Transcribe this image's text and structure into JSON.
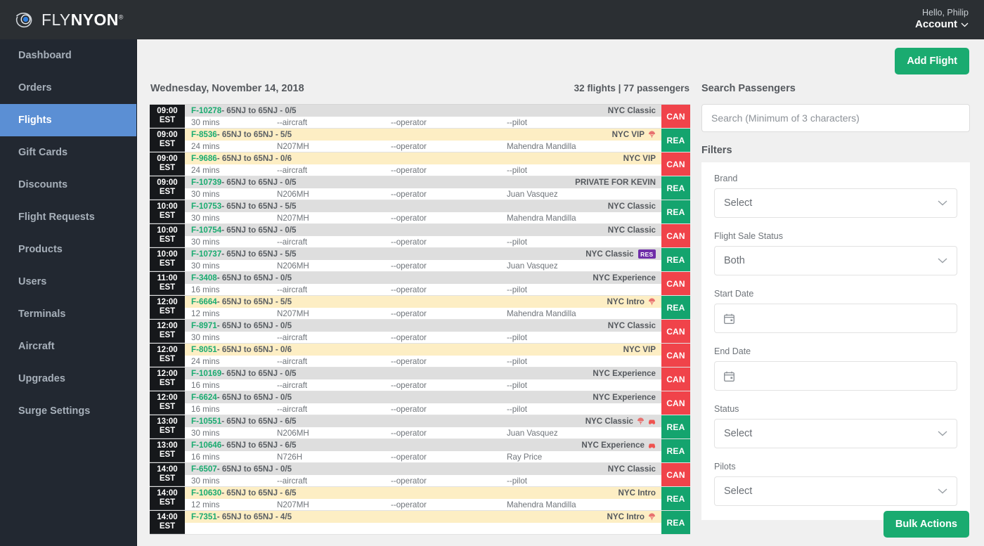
{
  "brand": {
    "name_light": "FLY",
    "name_bold": "NYON",
    "trademark": "®"
  },
  "header": {
    "greeting": "Hello, Philip",
    "account_label": "Account"
  },
  "sidebar": {
    "items": [
      {
        "label": "Dashboard",
        "active": false
      },
      {
        "label": "Orders",
        "active": false
      },
      {
        "label": "Flights",
        "active": true
      },
      {
        "label": "Gift Cards",
        "active": false
      },
      {
        "label": "Discounts",
        "active": false
      },
      {
        "label": "Flight Requests",
        "active": false
      },
      {
        "label": "Products",
        "active": false
      },
      {
        "label": "Users",
        "active": false
      },
      {
        "label": "Terminals",
        "active": false
      },
      {
        "label": "Aircraft",
        "active": false
      },
      {
        "label": "Upgrades",
        "active": false
      },
      {
        "label": "Surge Settings",
        "active": false
      }
    ]
  },
  "toolbar": {
    "add_flight_label": "Add Flight",
    "bulk_actions_label": "Bulk Actions"
  },
  "flight_list": {
    "date": "Wednesday, November 14, 2018",
    "summary": "32 flights | 77 passengers",
    "rows": [
      {
        "time": "09:00",
        "tz": "EST",
        "id": "F-10278",
        "route": " - 65NJ to 65NJ - 0/5",
        "duration": "30 mins",
        "aircraft": "--aircraft",
        "operator": "--operator",
        "pilot": "--pilot",
        "brand": "NYC Classic",
        "highlight": "grey",
        "status": "CAN",
        "icons": [],
        "res": false
      },
      {
        "time": "09:00",
        "tz": "EST",
        "id": "F-8536",
        "route": " - 65NJ to 65NJ - 5/5",
        "duration": "24 mins",
        "aircraft": "N207MH",
        "operator": "--operator",
        "pilot": "Mahendra Mandilla",
        "brand": "NYC VIP",
        "highlight": "yellow",
        "status": "REA",
        "icons": [
          "parachute-icon"
        ],
        "res": false
      },
      {
        "time": "09:00",
        "tz": "EST",
        "id": "F-9686",
        "route": " - 65NJ to 65NJ - 0/6",
        "duration": "24 mins",
        "aircraft": "--aircraft",
        "operator": "--operator",
        "pilot": "--pilot",
        "brand": "NYC VIP",
        "highlight": "yellow",
        "status": "CAN",
        "icons": [],
        "res": false
      },
      {
        "time": "09:00",
        "tz": "EST",
        "id": "F-10739",
        "route": " - 65NJ to 65NJ - 0/5",
        "duration": "30 mins",
        "aircraft": "N206MH",
        "operator": "--operator",
        "pilot": "Juan Vasquez",
        "brand": "PRIVATE FOR KEVIN",
        "highlight": "grey",
        "status": "REA",
        "icons": [],
        "res": false
      },
      {
        "time": "10:00",
        "tz": "EST",
        "id": "F-10753",
        "route": " - 65NJ to 65NJ - 5/5",
        "duration": "30 mins",
        "aircraft": "N207MH",
        "operator": "--operator",
        "pilot": "Mahendra Mandilla",
        "brand": "NYC Classic",
        "highlight": "grey",
        "status": "REA",
        "icons": [],
        "res": false
      },
      {
        "time": "10:00",
        "tz": "EST",
        "id": "F-10754",
        "route": " - 65NJ to 65NJ - 0/5",
        "duration": "30 mins",
        "aircraft": "--aircraft",
        "operator": "--operator",
        "pilot": "--pilot",
        "brand": "NYC Classic",
        "highlight": "grey",
        "status": "CAN",
        "icons": [],
        "res": false
      },
      {
        "time": "10:00",
        "tz": "EST",
        "id": "F-10737",
        "route": " - 65NJ to 65NJ - 5/5",
        "duration": "30 mins",
        "aircraft": "N206MH",
        "operator": "--operator",
        "pilot": "Juan Vasquez",
        "brand": "NYC Classic",
        "highlight": "grey",
        "status": "REA",
        "icons": [],
        "res": true,
        "res_label": "RES"
      },
      {
        "time": "11:00",
        "tz": "EST",
        "id": "F-3408",
        "route": " - 65NJ to 65NJ - 0/5",
        "duration": "16 mins",
        "aircraft": "--aircraft",
        "operator": "--operator",
        "pilot": "--pilot",
        "brand": "NYC Experience",
        "highlight": "grey",
        "status": "CAN",
        "icons": [],
        "res": false
      },
      {
        "time": "12:00",
        "tz": "EST",
        "id": "F-6664",
        "route": " - 65NJ to 65NJ - 5/5",
        "duration": "12 mins",
        "aircraft": "N207MH",
        "operator": "--operator",
        "pilot": "Mahendra Mandilla",
        "brand": "NYC Intro",
        "highlight": "yellow",
        "status": "REA",
        "icons": [
          "parachute-icon"
        ],
        "res": false
      },
      {
        "time": "12:00",
        "tz": "EST",
        "id": "F-8971",
        "route": " - 65NJ to 65NJ - 0/5",
        "duration": "30 mins",
        "aircraft": "--aircraft",
        "operator": "--operator",
        "pilot": "--pilot",
        "brand": "NYC Classic",
        "highlight": "grey",
        "status": "CAN",
        "icons": [],
        "res": false
      },
      {
        "time": "12:00",
        "tz": "EST",
        "id": "F-8051",
        "route": " - 65NJ to 65NJ - 0/6",
        "duration": "24 mins",
        "aircraft": "--aircraft",
        "operator": "--operator",
        "pilot": "--pilot",
        "brand": "NYC VIP",
        "highlight": "yellow",
        "status": "CAN",
        "icons": [],
        "res": false
      },
      {
        "time": "12:00",
        "tz": "EST",
        "id": "F-10169",
        "route": " - 65NJ to 65NJ - 0/5",
        "duration": "16 mins",
        "aircraft": "--aircraft",
        "operator": "--operator",
        "pilot": "--pilot",
        "brand": "NYC Experience",
        "highlight": "grey",
        "status": "CAN",
        "icons": [],
        "res": false
      },
      {
        "time": "12:00",
        "tz": "EST",
        "id": "F-6624",
        "route": " - 65NJ to 65NJ - 0/5",
        "duration": "16 mins",
        "aircraft": "--aircraft",
        "operator": "--operator",
        "pilot": "--pilot",
        "brand": "NYC Experience",
        "highlight": "grey",
        "status": "CAN",
        "icons": [],
        "res": false
      },
      {
        "time": "13:00",
        "tz": "EST",
        "id": "F-10551",
        "route": " - 65NJ to 65NJ - 6/5",
        "duration": "30 mins",
        "aircraft": "N206MH",
        "operator": "--operator",
        "pilot": "Juan Vasquez",
        "brand": "NYC Classic",
        "highlight": "grey",
        "status": "REA",
        "icons": [
          "parachute-icon",
          "car-icon"
        ],
        "res": false
      },
      {
        "time": "13:00",
        "tz": "EST",
        "id": "F-10646",
        "route": " - 65NJ to 65NJ - 6/5",
        "duration": "16 mins",
        "aircraft": "N726H",
        "operator": "--operator",
        "pilot": "Ray Price",
        "brand": "NYC Experience",
        "highlight": "grey",
        "status": "REA",
        "icons": [
          "car-icon"
        ],
        "res": false
      },
      {
        "time": "14:00",
        "tz": "EST",
        "id": "F-6507",
        "route": " - 65NJ to 65NJ - 0/5",
        "duration": "30 mins",
        "aircraft": "--aircraft",
        "operator": "--operator",
        "pilot": "--pilot",
        "brand": "NYC Classic",
        "highlight": "grey",
        "status": "CAN",
        "icons": [],
        "res": false
      },
      {
        "time": "14:00",
        "tz": "EST",
        "id": "F-10630",
        "route": " - 65NJ to 65NJ - 6/5",
        "duration": "12 mins",
        "aircraft": "N207MH",
        "operator": "--operator",
        "pilot": "Mahendra Mandilla",
        "brand": "NYC Intro",
        "highlight": "yellow",
        "status": "REA",
        "icons": [],
        "res": false
      },
      {
        "time": "14:00",
        "tz": "EST",
        "id": "F-7351",
        "route": " - 65NJ to 65NJ - 4/5",
        "duration": "",
        "aircraft": "",
        "operator": "",
        "pilot": "",
        "brand": "NYC Intro",
        "highlight": "yellow",
        "status": "REA",
        "icons": [
          "parachute-icon"
        ],
        "res": false
      }
    ]
  },
  "search": {
    "title": "Search Passengers",
    "placeholder": "Search (Minimum of 3 characters)"
  },
  "filters": {
    "title": "Filters",
    "fields": [
      {
        "label": "Brand",
        "value": "Select",
        "type": "select"
      },
      {
        "label": "Flight Sale Status",
        "value": "Both",
        "type": "select"
      },
      {
        "label": "Start Date",
        "value": "",
        "type": "date"
      },
      {
        "label": "End Date",
        "value": "",
        "type": "date"
      },
      {
        "label": "Status",
        "value": "Select",
        "type": "select"
      },
      {
        "label": "Pilots",
        "value": "Select",
        "type": "select"
      }
    ]
  },
  "colors": {
    "accent_green": "#1aab70",
    "status_cancelled": "#f0434a",
    "status_ready": "#14a46e",
    "sidebar_active": "#5b8fd4",
    "badge_res": "#6f2da8",
    "row_yellow": "#fdeec4",
    "row_grey": "#dedede"
  }
}
